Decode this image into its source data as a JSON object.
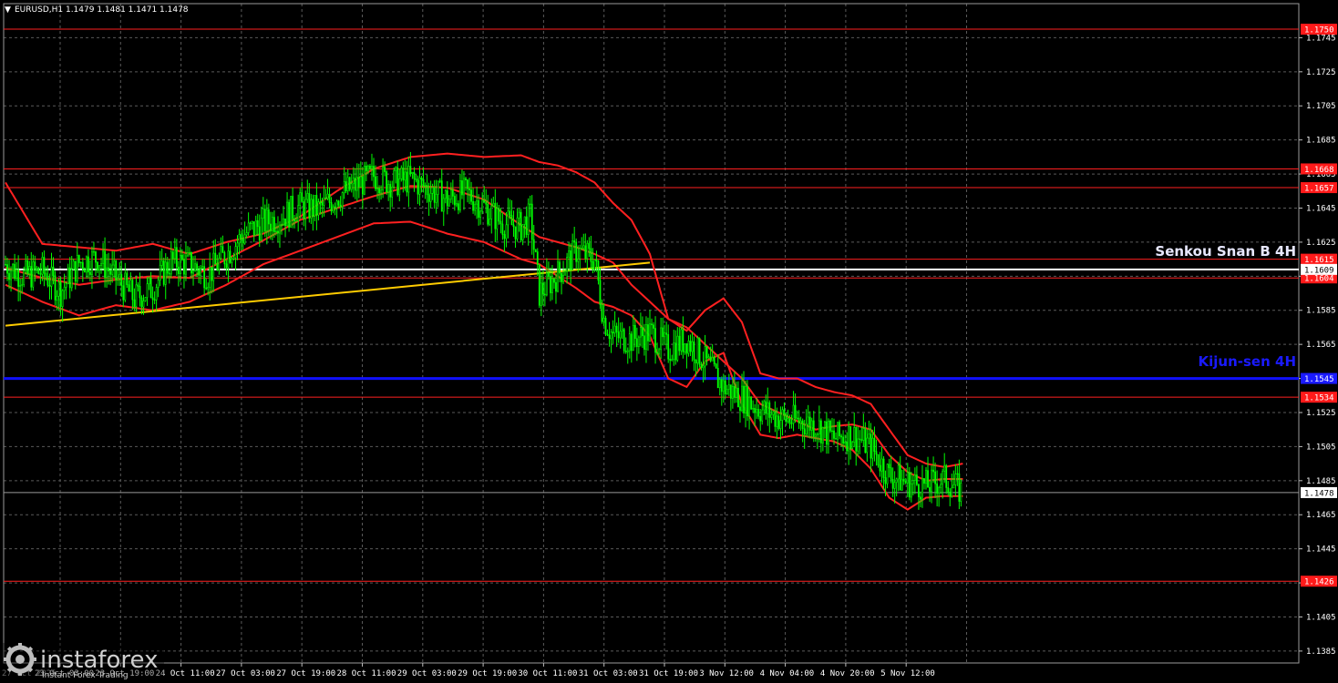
{
  "header": {
    "symbol_text": "EURUSD,H1  1.1479 1.1481 1.1471 1.1478",
    "arrow": "▼"
  },
  "chart_data": {
    "type": "candlestick",
    "symbol": "EURUSD",
    "timeframe": "H1",
    "ohlc_last": {
      "open": 1.1479,
      "high": 1.1481,
      "low": 1.1471,
      "close": 1.1478
    },
    "ylim": [
      1.1378,
      1.1765
    ],
    "price_ticks": [
      1.1745,
      1.1725,
      1.1705,
      1.1685,
      1.1665,
      1.1645,
      1.1625,
      1.1605,
      1.1585,
      1.1565,
      1.1545,
      1.1525,
      1.1505,
      1.1485,
      1.1465,
      1.1445,
      1.1425,
      1.1405,
      1.1385
    ],
    "time_labels": [
      "23 Oct 03:00",
      "23 Oct 19:00",
      "24 Oct 11:00",
      "27 Oct 03:00",
      "27 Oct 19:00",
      "28 Oct 11:00",
      "29 Oct 03:00",
      "29 Oct 19:00",
      "30 Oct 11:00",
      "31 Oct 03:00",
      "31 Oct 19:00",
      "3 Nov 12:00",
      "4 Nov 04:00",
      "4 Nov 20:00",
      "5 Nov 12:00"
    ],
    "levels": [
      {
        "price": 1.175,
        "label": "1.1750",
        "color": "#ff2020"
      },
      {
        "price": 1.1668,
        "label": "1.1668",
        "color": "#ff2020"
      },
      {
        "price": 1.1657,
        "label": "1.1657",
        "color": "#ff2020"
      },
      {
        "price": 1.1615,
        "label": "1.1615",
        "color": "#ff2020"
      },
      {
        "price": 1.1604,
        "label": "1.1604",
        "color": "#ff2020"
      },
      {
        "price": 1.1534,
        "label": "1.1534",
        "color": "#ff2020"
      },
      {
        "price": 1.1426,
        "label": "1.1426",
        "color": "#ff2020"
      }
    ],
    "senkou_span_b": {
      "price": 1.1609,
      "label": "1.1609",
      "text": "Senkou Snan B 4H",
      "color": "#ffffff"
    },
    "kijun_sen": {
      "price": 1.1545,
      "label": "1.1545",
      "text": "Kijun-sen 4H",
      "color": "#1010ff"
    },
    "current_price": {
      "price": 1.1478,
      "label": "1.1478"
    },
    "trendline": {
      "from": {
        "bar": 0,
        "price": 1.1576
      },
      "to": {
        "bar": 350,
        "price": 1.1613
      },
      "color": "#ffcc00"
    },
    "bollinger": {
      "anchor_bars": [
        0,
        20,
        40,
        60,
        80,
        100,
        120,
        140,
        160,
        180,
        200,
        220,
        240,
        260,
        280,
        290,
        300,
        310,
        320,
        330,
        340,
        350,
        360,
        370,
        380,
        390,
        400,
        410,
        420,
        430,
        440,
        450,
        460,
        470,
        480,
        490,
        500,
        510,
        520
      ],
      "upper": [
        1.166,
        1.1624,
        1.1622,
        1.162,
        1.1624,
        1.1618,
        1.1625,
        1.163,
        1.164,
        1.1655,
        1.1668,
        1.1675,
        1.1677,
        1.1675,
        1.1676,
        1.1672,
        1.167,
        1.1666,
        1.166,
        1.1648,
        1.1638,
        1.1618,
        1.158,
        1.1573,
        1.1585,
        1.1592,
        1.1578,
        1.1548,
        1.1545,
        1.1545,
        1.154,
        1.1537,
        1.1535,
        1.153,
        1.1515,
        1.15,
        1.1495,
        1.1493,
        1.1495
      ],
      "middle": [
        1.161,
        1.1604,
        1.16,
        1.1603,
        1.1605,
        1.1604,
        1.1615,
        1.1626,
        1.1638,
        1.1645,
        1.1652,
        1.1658,
        1.1657,
        1.165,
        1.1635,
        1.1628,
        1.1625,
        1.1622,
        1.1618,
        1.1613,
        1.16,
        1.159,
        1.158,
        1.1575,
        1.1565,
        1.1555,
        1.1545,
        1.153,
        1.1525,
        1.152,
        1.1515,
        1.1517,
        1.1518,
        1.1515,
        1.15,
        1.149,
        1.1485,
        1.1486,
        1.1486
      ],
      "lower": [
        1.16,
        1.159,
        1.1582,
        1.1588,
        1.1585,
        1.159,
        1.16,
        1.1612,
        1.162,
        1.1628,
        1.1636,
        1.1637,
        1.163,
        1.1625,
        1.1615,
        1.1612,
        1.1605,
        1.1598,
        1.159,
        1.1587,
        1.1582,
        1.157,
        1.1545,
        1.154,
        1.1555,
        1.156,
        1.153,
        1.1512,
        1.151,
        1.1512,
        1.151,
        1.1508,
        1.1503,
        1.1492,
        1.1475,
        1.1468,
        1.1475,
        1.1476,
        1.1476
      ]
    },
    "price_path": {
      "anchor_bars": [
        0,
        10,
        20,
        30,
        40,
        50,
        60,
        70,
        80,
        90,
        100,
        110,
        120,
        130,
        140,
        150,
        160,
        170,
        180,
        190,
        200,
        210,
        220,
        230,
        240,
        250,
        260,
        270,
        280,
        285,
        290,
        300,
        310,
        320,
        325,
        330,
        340,
        350,
        360,
        370,
        380,
        390,
        400,
        410,
        420,
        430,
        440,
        450,
        460,
        470,
        480,
        490,
        500,
        510,
        520
      ],
      "close": [
        1.1612,
        1.1605,
        1.1608,
        1.1596,
        1.1613,
        1.1616,
        1.1604,
        1.1592,
        1.1598,
        1.1614,
        1.1612,
        1.1606,
        1.1618,
        1.163,
        1.1636,
        1.164,
        1.1646,
        1.1644,
        1.1652,
        1.1658,
        1.1664,
        1.166,
        1.1662,
        1.1656,
        1.165,
        1.1654,
        1.1646,
        1.1636,
        1.1634,
        1.164,
        1.1595,
        1.1606,
        1.162,
        1.1615,
        1.158,
        1.157,
        1.1568,
        1.1572,
        1.1562,
        1.1568,
        1.1555,
        1.154,
        1.1534,
        1.1527,
        1.1522,
        1.152,
        1.1518,
        1.151,
        1.1512,
        1.1505,
        1.1488,
        1.1484,
        1.1482,
        1.1486,
        1.1478
      ]
    },
    "bar_count": 520,
    "colors": {
      "background": "#000000",
      "grid": "#5a5a5a",
      "candle_up": "#00ff00",
      "candle_down": "#00ff00",
      "axis_text": "#ffffff",
      "bollinger": "#ff2020"
    }
  },
  "watermark": {
    "brand": "instaforex",
    "tagline": "Instant Forex Trading"
  },
  "left_axis_partial": "27 Oct 2025"
}
